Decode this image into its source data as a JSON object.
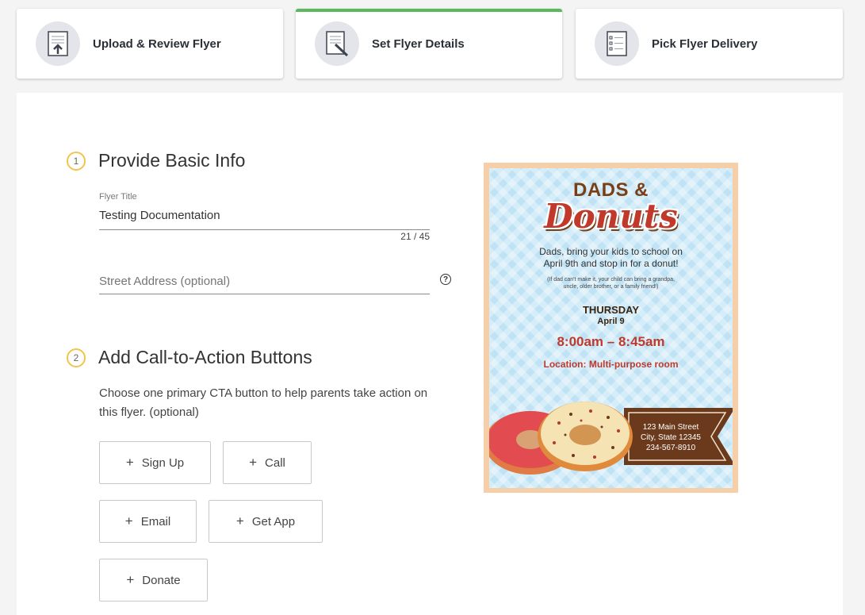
{
  "steps": [
    {
      "label": "Upload & Review Flyer",
      "icon": "upload-document-icon",
      "active": false
    },
    {
      "label": "Set Flyer Details",
      "icon": "edit-document-icon",
      "active": true
    },
    {
      "label": "Pick Flyer Delivery",
      "icon": "checklist-icon",
      "active": false
    }
  ],
  "colors": {
    "active_step": "#5cb85c",
    "step_number_ring": "#f1c44a",
    "icon_bg": "#e3e5ea"
  },
  "section1": {
    "number": "1",
    "title": "Provide Basic Info",
    "flyer_title": {
      "label": "Flyer Title",
      "value": "Testing Documentation",
      "counter": "21 / 45"
    },
    "street_address": {
      "placeholder": "Street Address (optional)",
      "help": "?"
    }
  },
  "section2": {
    "number": "2",
    "title": "Add Call-to-Action Buttons",
    "description": "Choose one primary CTA button to help parents take action on this flyer. (optional)",
    "buttons": [
      {
        "label": "Sign Up"
      },
      {
        "label": "Call"
      },
      {
        "label": "Email"
      },
      {
        "label": "Get App"
      },
      {
        "label": "Donate"
      }
    ]
  },
  "flyer": {
    "heading": "DADS &",
    "script_title": "Donuts",
    "line1": "Dads, bring your kids to school on",
    "line2": "April 9th and stop in for a donut!",
    "small_line1": "(If dad can't make it, your child can bring a grandpa,",
    "small_line2": "uncle, older brother, or a family friend!)",
    "day": "THURSDAY",
    "date": "April 9",
    "time": "8:00am – 8:45am",
    "location": "Location: Multi-purpose room",
    "address1": "123 Main Street",
    "address2": "City, State 12345",
    "phone": "234-567-8910"
  }
}
